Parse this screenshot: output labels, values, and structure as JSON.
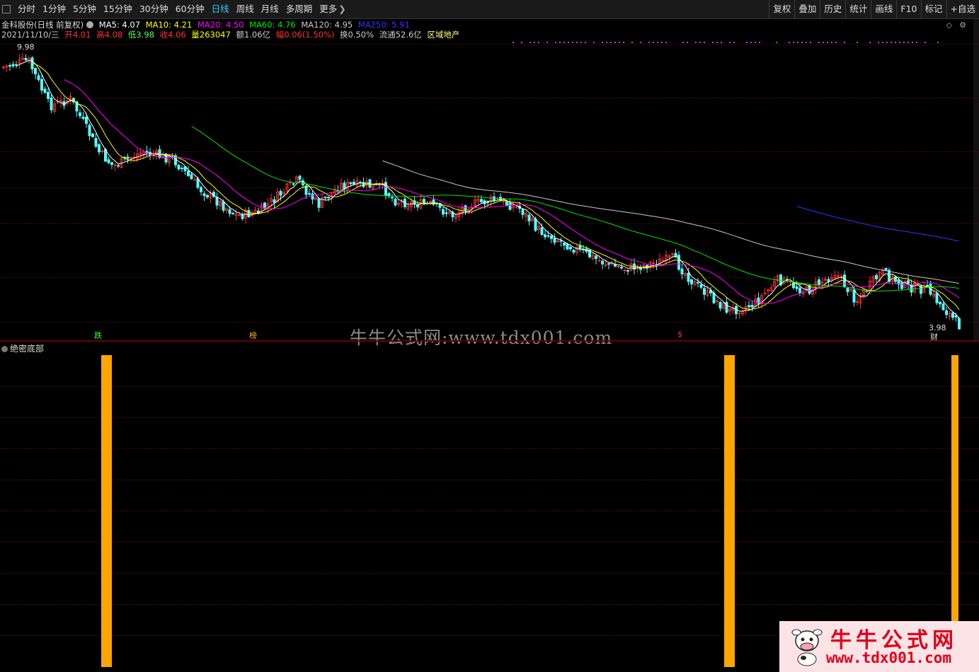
{
  "toolbar": {
    "tabs": [
      {
        "label": "分时",
        "active": false
      },
      {
        "label": "1分钟",
        "active": false
      },
      {
        "label": "5分钟",
        "active": false
      },
      {
        "label": "15分钟",
        "active": false
      },
      {
        "label": "30分钟",
        "active": false
      },
      {
        "label": "60分钟",
        "active": false
      },
      {
        "label": "日线",
        "active": true
      },
      {
        "label": "周线",
        "active": false
      },
      {
        "label": "月线",
        "active": false
      },
      {
        "label": "多周期",
        "active": false
      },
      {
        "label": "更多",
        "active": false
      }
    ],
    "right_tools": [
      "复权",
      "叠加",
      "历史",
      "统计",
      "画线",
      "F10",
      "标记",
      "+自选"
    ]
  },
  "info": {
    "stock_name": "金科股份(日线 前复权)",
    "ma5": "MA5: 4.07",
    "ma10": "MA10: 4.21",
    "ma20": "MA20: 4.50",
    "ma60": "MA60: 4.76",
    "ma120": "MA120: 4.95",
    "ma250": "MA250: 5.91",
    "date": "2021/11/10/三",
    "open": "开4.01",
    "high": "高4.08",
    "low": "低3.98",
    "close": "收4.06",
    "volume": "量263047",
    "amount": "额1.06亿",
    "change": "幅0.06(1.50%)",
    "turnover": "换0.50%",
    "float": "流通52.6亿",
    "sector": "区域地产"
  },
  "chart": {
    "high_label": "9.98",
    "low_label": "3.98",
    "markers": {
      "die": "跌",
      "bang": "榜",
      "dollar": "$",
      "cai": "财"
    }
  },
  "indicator": {
    "title": "绝密底部",
    "signal_bars": 3
  },
  "watermark": "牛牛公式网:www.tdx001.com",
  "logo": {
    "line1": "牛牛公式网",
    "line2": "www.tdx001.com"
  },
  "colors": {
    "up": "#ff3232",
    "down": "#54ffff",
    "ma5": "#ffffff",
    "ma10": "#ffff00",
    "ma20": "#ff00ff",
    "ma60": "#00e600",
    "ma120": "#c8c8c8",
    "ma250": "#3333ff",
    "signal": "#ffa500"
  }
}
